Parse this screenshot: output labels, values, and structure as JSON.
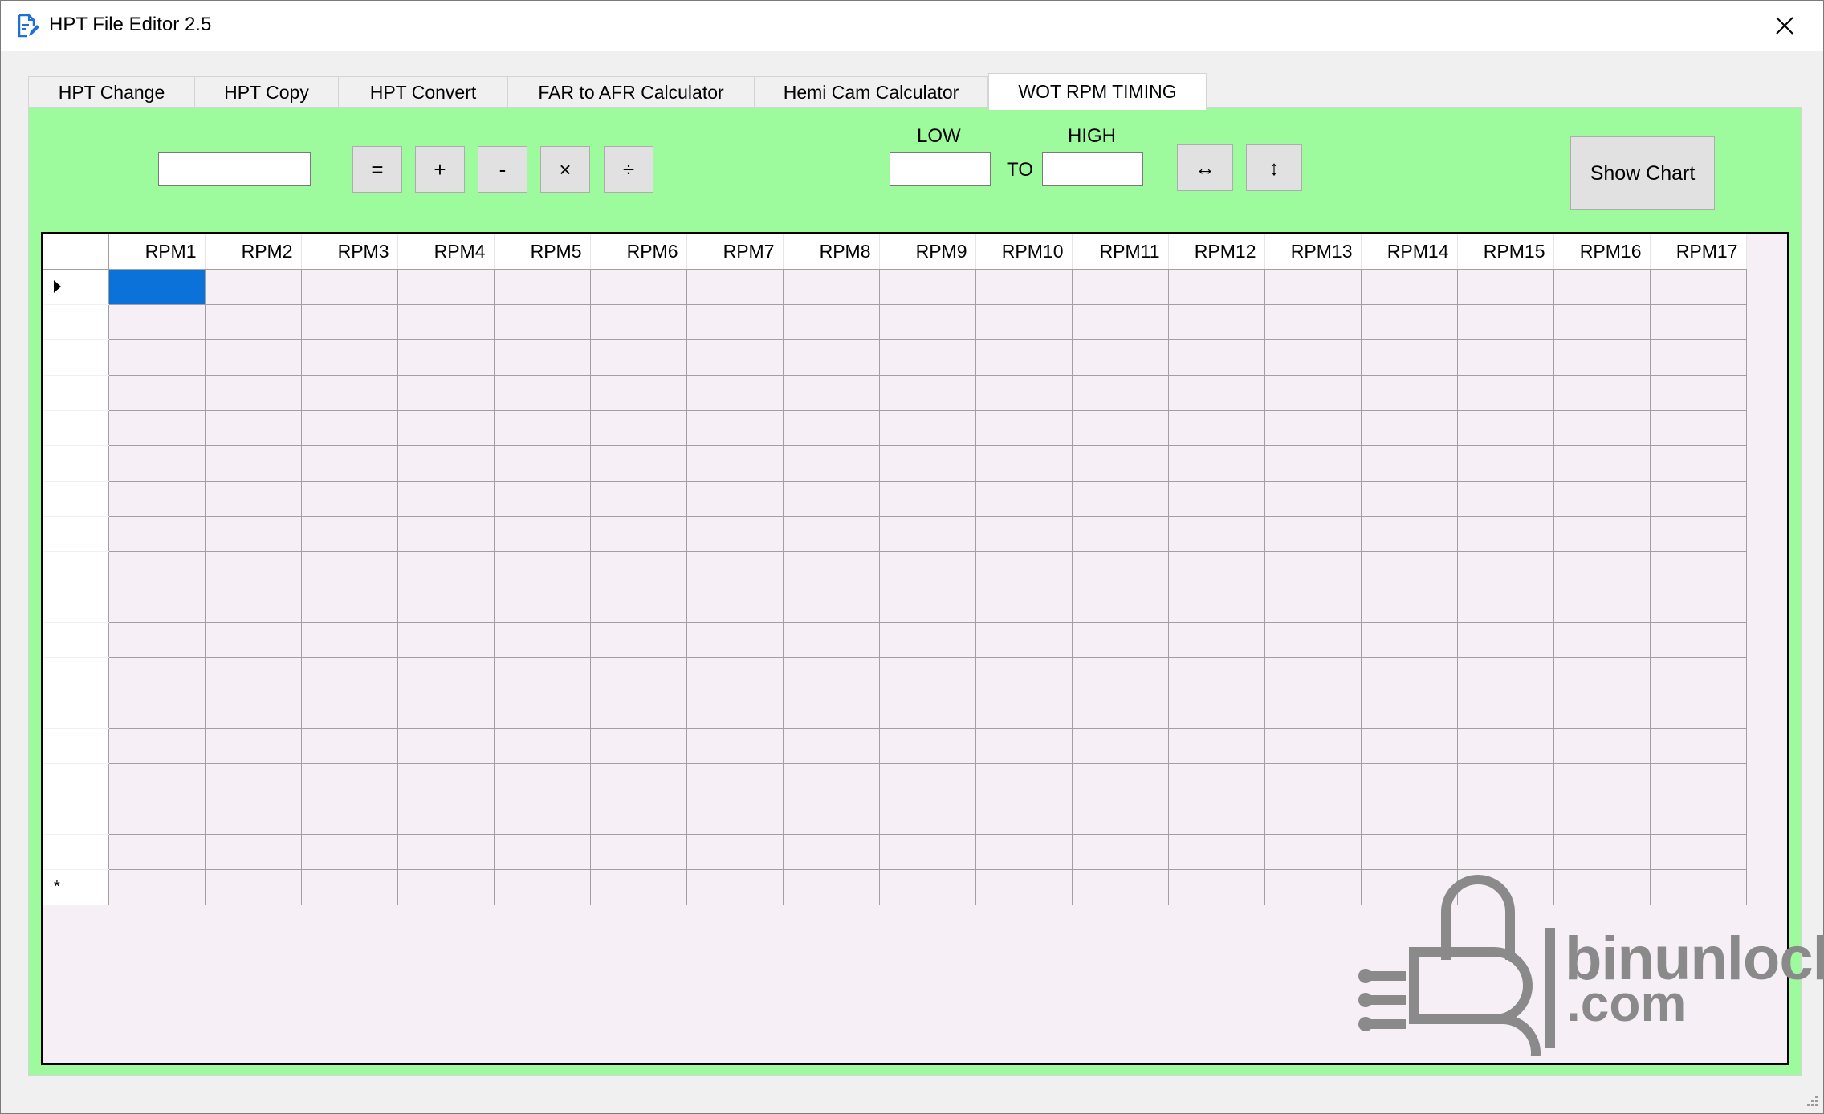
{
  "window": {
    "title": "HPT File Editor 2.5"
  },
  "tabs": [
    {
      "label": "HPT Change"
    },
    {
      "label": "HPT Copy"
    },
    {
      "label": "HPT Convert"
    },
    {
      "label": "FAR to AFR Calculator"
    },
    {
      "label": "Hemi Cam Calculator"
    },
    {
      "label": "WOT RPM TIMING",
      "active": true
    }
  ],
  "toolbar": {
    "value_input": "",
    "ops": [
      "=",
      "+",
      "-",
      "×",
      "÷"
    ],
    "low_label": "LOW",
    "high_label": "HIGH",
    "to_label": "TO",
    "low_value": "",
    "high_value": "",
    "horizontal_icon": "↔",
    "vertical_icon": "↕",
    "show_chart_label": "Show Chart"
  },
  "grid": {
    "columns": [
      "RPM1",
      "RPM2",
      "RPM3",
      "RPM4",
      "RPM5",
      "RPM6",
      "RPM7",
      "RPM8",
      "RPM9",
      "RPM10",
      "RPM11",
      "RPM12",
      "RPM13",
      "RPM14",
      "RPM15",
      "RPM16",
      "RPM17"
    ],
    "new_row_marker": "*"
  },
  "watermark": {
    "line1": "binunlock",
    "line2": ".com"
  },
  "colors": {
    "panel": "#9dfa9d",
    "selection": "#0a72d9",
    "grid_bg": "#f6f0f6"
  }
}
